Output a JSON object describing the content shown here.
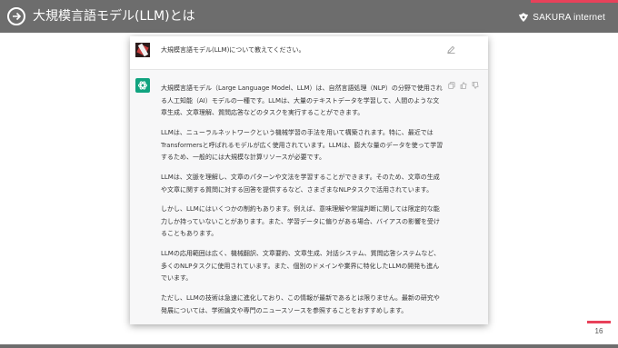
{
  "header": {
    "title": "大規模言語モデル(LLM)とは",
    "logo_text": "SAKURA internet"
  },
  "chat": {
    "user_message": "大規模言語モデル(LLM)について教えてください。",
    "answer": [
      "大規模言語モデル（Large Language Model、LLM）は、自然言語処理（NLP）の分野で使用される人工知能（AI）モデルの一種です。LLMは、大量のテキストデータを学習して、人間のような文章生成、文章理解、質問応答などのタスクを実行することができます。",
      "LLMは、ニューラルネットワークという機械学習の手法を用いて構築されます。特に、最近ではTransformersと呼ばれるモデルが広く使用されています。LLMは、膨大な量のデータを使って学習するため、一般的には大規模な計算リソースが必要です。",
      "LLMは、文脈を理解し、文章のパターンや文法を学習することができます。そのため、文章の生成や文章に関する質問に対する回答を提供するなど、さまざまなNLPタスクで活用されています。",
      "しかし、LLMにはいくつかの制約もあります。例えば、意味理解や常識判断に関しては限定的な能力しか持っていないことがあります。また、学習データに偏りがある場合、バイアスの影響を受けることもあります。",
      "LLMの応用範囲は広く、機械翻訳、文章要約、文章生成、対話システム、質問応答システムなど、多くのNLPタスクに使用されています。また、個別のドメインや業界に特化したLLMの開発も進んでいます。",
      "ただし、LLMの技術は急速に進化しており、この情報が最新であるとは限りません。最新の研究や発展については、学術論文や専門のニュースソースを参照することをおすすめします。"
    ]
  },
  "footer": {
    "page_number": "16"
  },
  "colors": {
    "header_bg": "#6d6d6d",
    "accent": "#e8415a",
    "bot_icon": "#10a37f"
  },
  "icons": [
    "arrow-right-icon",
    "sakura-logo-icon",
    "edit-icon",
    "copy-icon",
    "thumbs-up-icon",
    "thumbs-down-icon",
    "openai-icon"
  ]
}
